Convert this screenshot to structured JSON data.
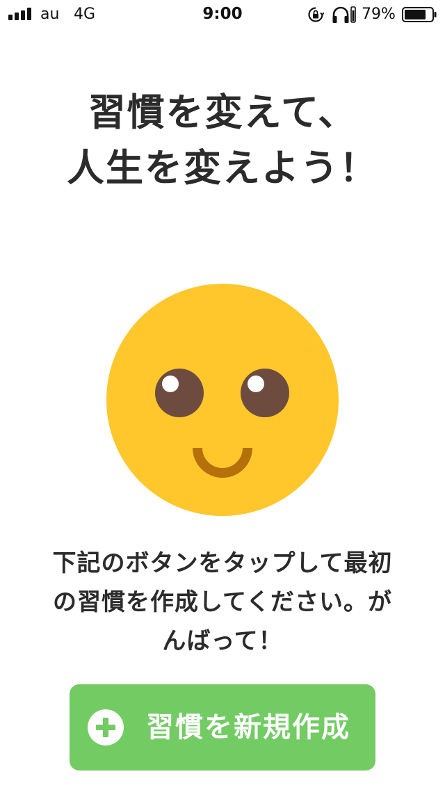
{
  "status_bar": {
    "carrier": "au",
    "network": "4G",
    "time": "9:00",
    "battery_percent": "79%",
    "battery_level": 0.79,
    "icons": [
      "signal-icon",
      "orientation-lock-icon",
      "headphones-icon",
      "battery-icon"
    ]
  },
  "headline": {
    "line1": "習慣を変えて、",
    "line2": "人生を変えよう！"
  },
  "illustration": {
    "icon": "smiley-face-icon",
    "colors": {
      "face": "#ffc72c",
      "eyes": "#6d4c3f",
      "eye_highlight": "#ffffff",
      "mouth": "#b5700a"
    }
  },
  "message": {
    "line1": "下記のボタンをタップして最初",
    "line2": "の習慣を作成してください。が",
    "line3": "んばって！"
  },
  "create_button": {
    "label": "習慣を新規作成",
    "icon": "plus-circle-icon",
    "color": "#72cb63"
  }
}
